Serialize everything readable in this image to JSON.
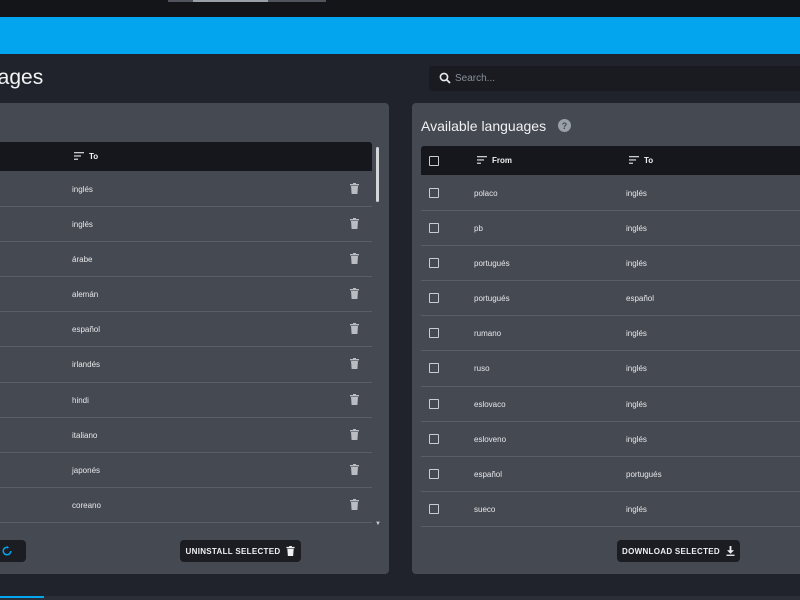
{
  "header": {
    "title": "uages",
    "search_placeholder": "Search..."
  },
  "installed": {
    "columns": {
      "to": "To"
    },
    "rows": [
      {
        "to": "inglés"
      },
      {
        "to": "inglés"
      },
      {
        "to": "árabe"
      },
      {
        "to": "alemán"
      },
      {
        "to": "español"
      },
      {
        "to": "irlandés"
      },
      {
        "to": "hindi"
      },
      {
        "to": "italiano"
      },
      {
        "to": "japonés"
      },
      {
        "to": "coreano"
      }
    ],
    "uninstall_label": "UNINSTALL SELECTED"
  },
  "available": {
    "title": "Available languages",
    "columns": {
      "from": "From",
      "to": "To"
    },
    "rows": [
      {
        "from": "polaco",
        "to": "inglés"
      },
      {
        "from": "pb",
        "to": "inglés"
      },
      {
        "from": "portugués",
        "to": "inglés"
      },
      {
        "from": "portugués",
        "to": "español"
      },
      {
        "from": "rumano",
        "to": "inglés"
      },
      {
        "from": "ruso",
        "to": "inglés"
      },
      {
        "from": "eslovaco",
        "to": "inglés"
      },
      {
        "from": "esloveno",
        "to": "inglés"
      },
      {
        "from": "español",
        "to": "portugués"
      },
      {
        "from": "sueco",
        "to": "inglés"
      }
    ],
    "download_label": "DOWNLOAD SELECTED"
  },
  "colors": {
    "accent": "#03a5ee",
    "background": "#20232b",
    "panel": "#454951",
    "table_header": "#15171c"
  }
}
